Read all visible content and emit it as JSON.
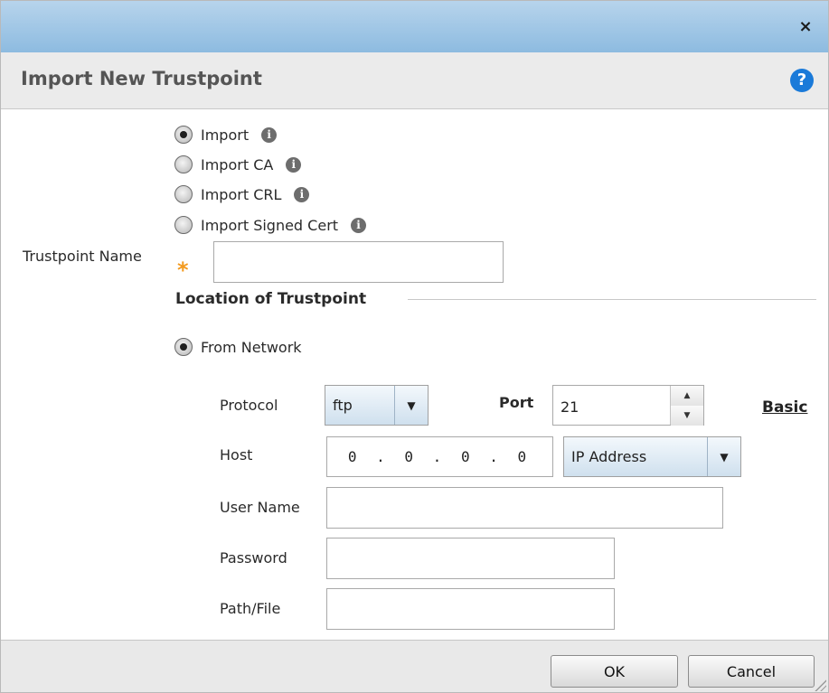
{
  "dialog": {
    "close_glyph": "×",
    "title": "Import New Trustpoint",
    "help_glyph": "?"
  },
  "import_options": [
    {
      "label": "Import",
      "checked": true
    },
    {
      "label": "Import CA",
      "checked": false
    },
    {
      "label": "Import CRL",
      "checked": false
    },
    {
      "label": "Import Signed Cert",
      "checked": false
    }
  ],
  "info_glyph": "i",
  "trustpoint": {
    "label": "Trustpoint Name",
    "required_glyph": "*",
    "value": ""
  },
  "location": {
    "section_title": "Location of Trustpoint",
    "from_network_label": "From Network",
    "from_network_checked": true
  },
  "network": {
    "protocol_label": "Protocol",
    "protocol_value": "ftp",
    "port_label": "Port",
    "port_value": "21",
    "basic_link": "Basic",
    "host_label": "Host",
    "host_value": "0 . 0 . 0 . 0",
    "host_type_value": "IP Address",
    "username_label": "User Name",
    "username_value": "",
    "password_label": "Password",
    "password_value": "",
    "path_label": "Path/File",
    "path_value": ""
  },
  "footer": {
    "ok_label": "OK",
    "cancel_label": "Cancel"
  },
  "colors": {
    "titlebar_top": "#b7d4ec",
    "titlebar_bottom": "#8dbbe0",
    "required": "#f39a1e",
    "help": "#1a7ad9"
  }
}
